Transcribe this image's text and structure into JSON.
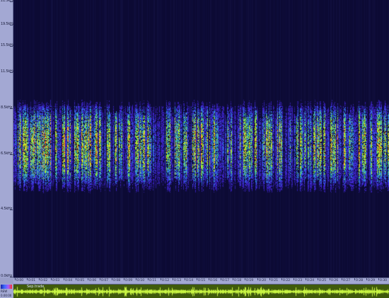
{
  "frequency_axis": {
    "ticks": [
      {
        "label": "21.5kHz",
        "pos": 0.005
      },
      {
        "label": "19.5kHz",
        "pos": 0.09
      },
      {
        "label": "15.5kHz",
        "pos": 0.165
      },
      {
        "label": "11.5kHz",
        "pos": 0.26
      },
      {
        "label": "8.5kHz",
        "pos": 0.39
      },
      {
        "label": "6.5kHz",
        "pos": 0.555
      },
      {
        "label": "4.5kHz",
        "pos": 0.755
      },
      {
        "label": "0.0kHz",
        "pos": 0.998
      }
    ]
  },
  "time_axis": {
    "labels": [
      "0:00",
      "0:01",
      "0:02",
      "0:03",
      "0:04",
      "0:05",
      "0:06",
      "0:07",
      "0:08",
      "0:09",
      "0:10",
      "0:11",
      "0:12",
      "0:13",
      "0:14",
      "0:15",
      "0:16",
      "0:17",
      "0:18",
      "0:19",
      "0:20",
      "0:21",
      "0:22",
      "0:23",
      "0:24",
      "0:25",
      "0:26",
      "0:27",
      "0:28",
      "0:29",
      "0:30"
    ]
  },
  "track": {
    "name": "Sep.trade",
    "info_line1": "REW",
    "info_line2": "0.00:00"
  },
  "colors": {
    "background": "#0c0a34",
    "panel": "#a3a8d3",
    "waveform_bg": "#3f5a0c",
    "waveform": "#c8f542"
  }
}
